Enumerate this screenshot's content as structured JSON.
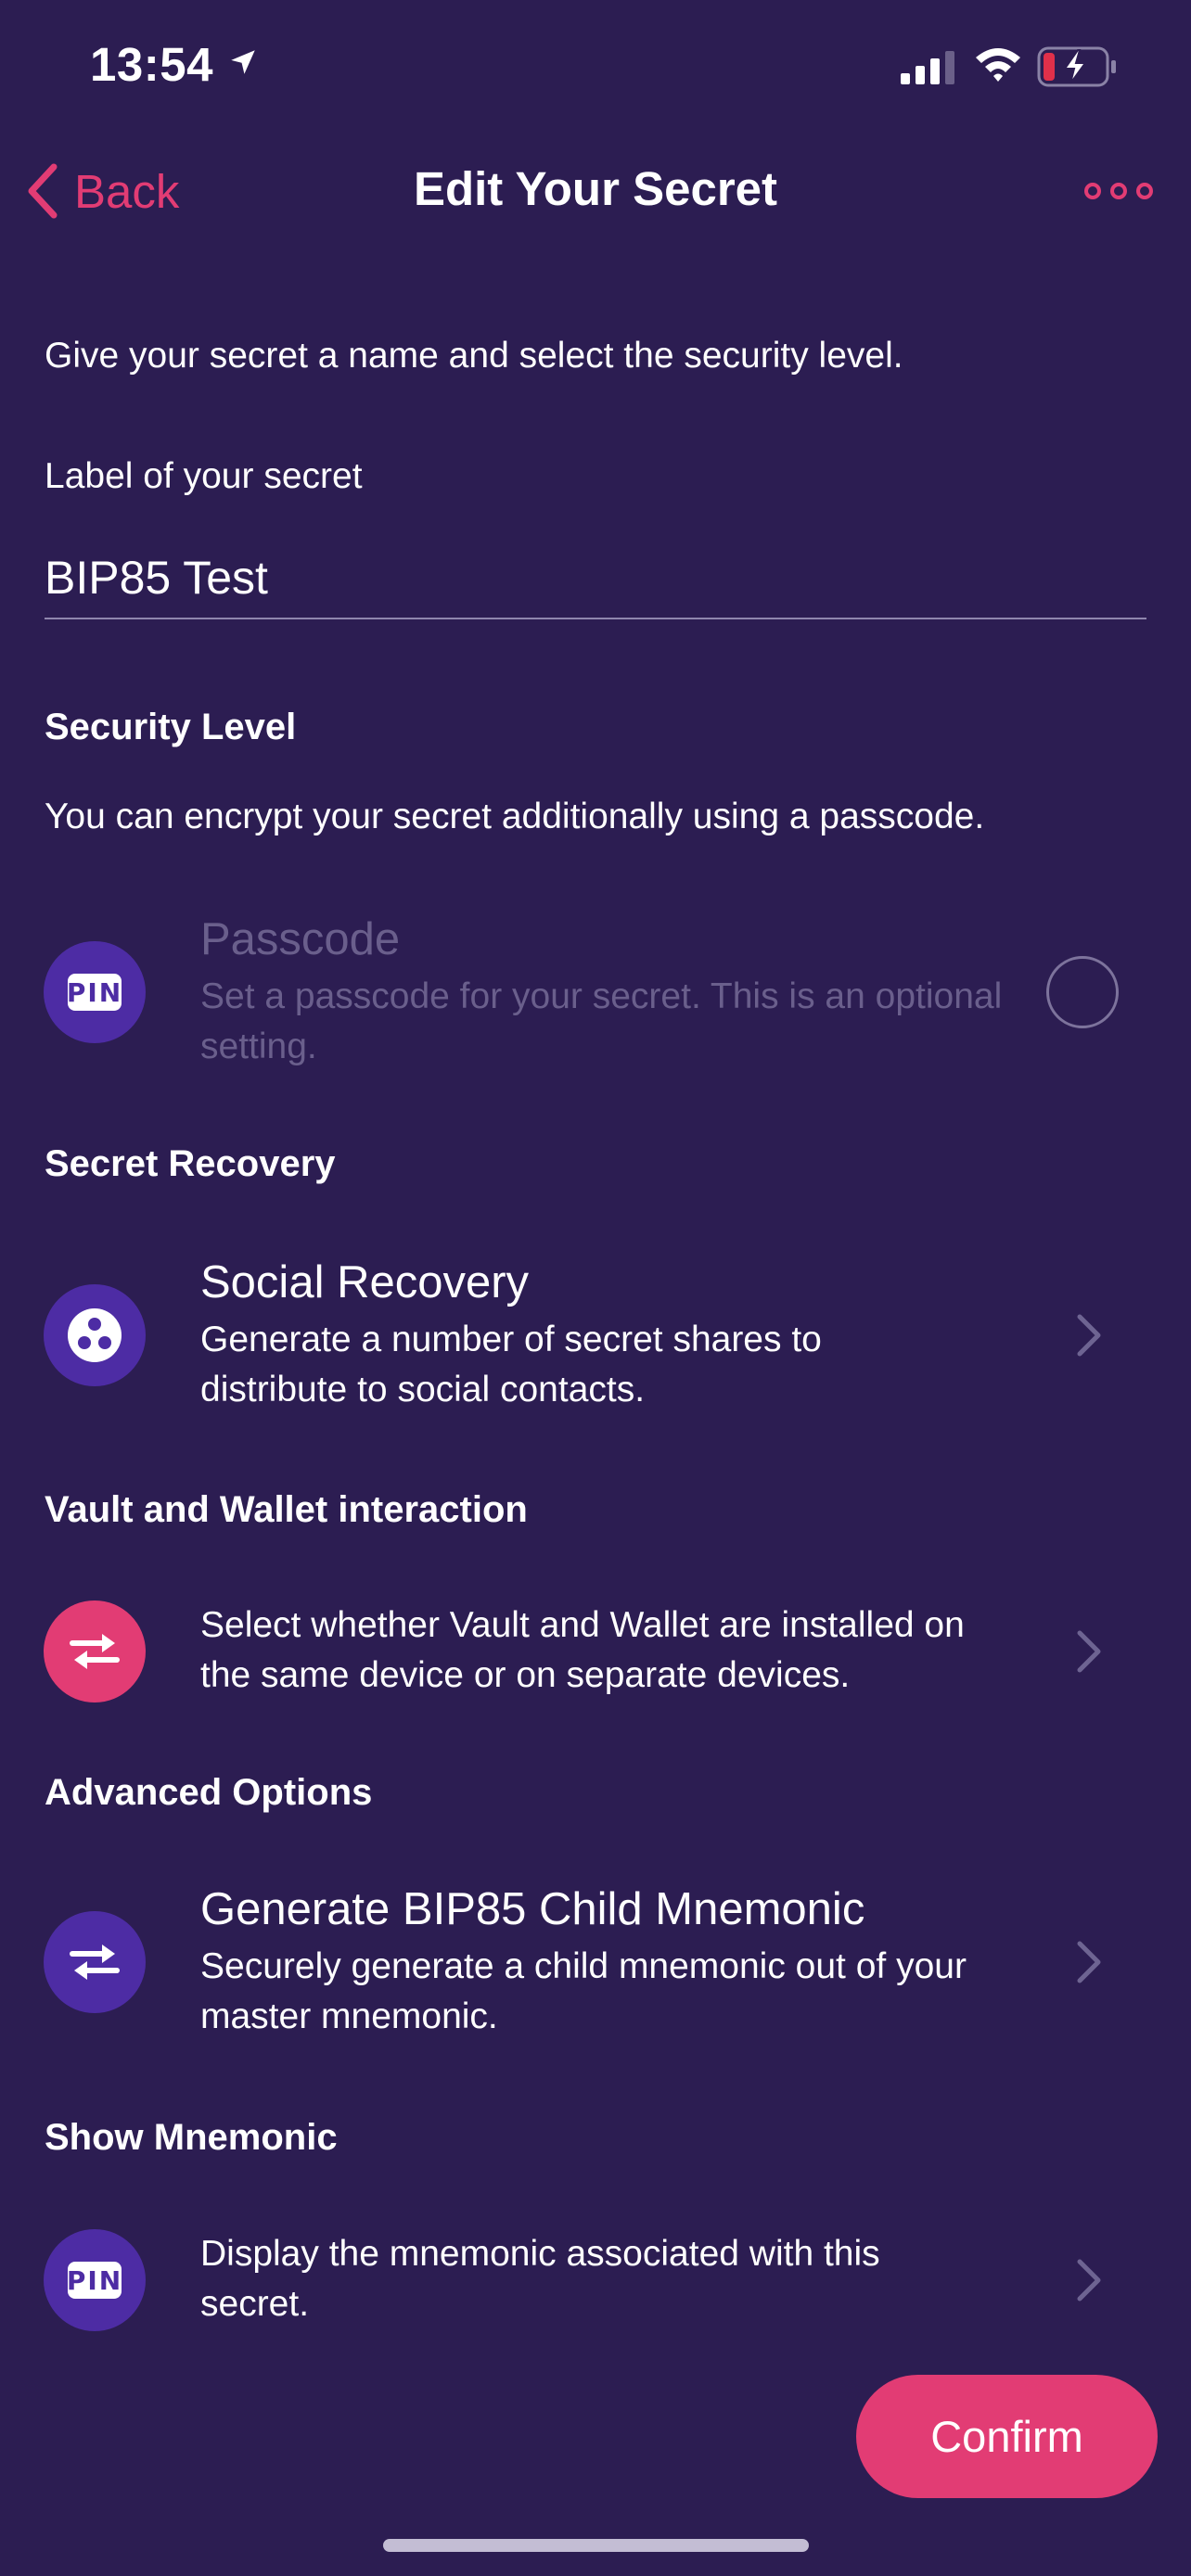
{
  "status_bar": {
    "time": "13:54"
  },
  "nav": {
    "back_label": "Back",
    "title": "Edit Your Secret"
  },
  "intro": "Give your secret a name and select the security level.",
  "label_field": {
    "label": "Label of your secret",
    "value": "BIP85 Test"
  },
  "security": {
    "title": "Security Level",
    "description": "You can encrypt your secret additionally using a passcode.",
    "passcode": {
      "icon_text": "PIN",
      "title": "Passcode",
      "description": "Set a passcode for your secret. This is an optional setting.",
      "selected": false
    }
  },
  "recovery": {
    "title": "Secret Recovery",
    "social": {
      "title": "Social Recovery",
      "description": "Generate a number of secret shares to distribute to social contacts."
    }
  },
  "interaction": {
    "title": "Vault and Wallet interaction",
    "description": "Select whether Vault and Wallet are installed on the same device or on separate devices."
  },
  "advanced": {
    "title": "Advanced Options",
    "bip85": {
      "title": "Generate BIP85 Child Mnemonic",
      "description": "Securely generate a child mnemonic out of your master mnemonic."
    }
  },
  "mnemonic": {
    "title": "Show Mnemonic",
    "icon_text": "PIN",
    "description": "Display the mnemonic associated with this secret."
  },
  "confirm_label": "Confirm",
  "colors": {
    "background": "#2c1d52",
    "accent": "#e23c74",
    "icon_circle": "#4d2ca4"
  }
}
